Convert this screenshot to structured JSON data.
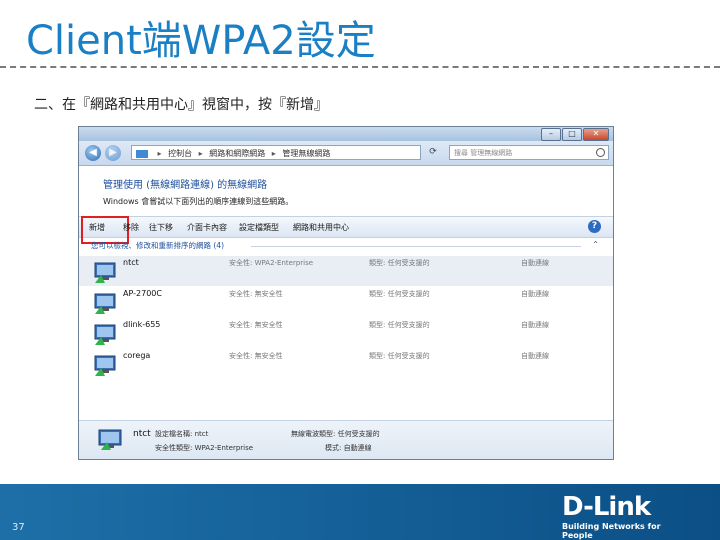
{
  "slide": {
    "title": "Client端WPA2設定",
    "instruction": "二、在『網路和共用中心』視窗中，按『新增』",
    "page_number": "37"
  },
  "window": {
    "controls": {
      "minimize": "–",
      "maximize": "□",
      "close": "✕"
    },
    "address": {
      "crumbs": [
        "控制台",
        "網路和網際網路",
        "管理無線網路"
      ],
      "search_placeholder": "搜尋 管理無線網路"
    },
    "heading": "管理使用 (無線網路連線) 的無線網路",
    "subtext": "Windows 會嘗試以下面列出的順序連線到這些網路。",
    "toolbar": {
      "items": [
        "新增",
        "移除",
        "往下移",
        "介面卡內容",
        "設定檔類型",
        "網路和共用中心"
      ]
    },
    "group_header": "您可以檢視、修改和重新排序的網路 (4)",
    "networks": [
      {
        "name": "ntct",
        "security": "安全性: WPA2-Enterprise",
        "type": "類型: 任何受支援的",
        "mode": "自動連線"
      },
      {
        "name": "AP-2700C",
        "security": "安全性: 無安全性",
        "type": "類型: 任何受支援的",
        "mode": "自動連線"
      },
      {
        "name": "dlink-655",
        "security": "安全性: 無安全性",
        "type": "類型: 任何受支援的",
        "mode": "自動連線"
      },
      {
        "name": "corega",
        "security": "安全性: 無安全性",
        "type": "類型: 任何受支援的",
        "mode": "自動連線"
      }
    ],
    "details": {
      "name": "ntct",
      "profile_label": "設定檔名稱: ntct",
      "security_label": "安全性類型: WPA2-Enterprise",
      "radio_label": "無線電波類型: 任何受支援的",
      "mode_label": "模式: 自動連線"
    }
  },
  "footer": {
    "logo_text": "D-Link",
    "logo_tagline": "Building Networks for People"
  },
  "colors": {
    "title": "#1a7fc4",
    "footer": "#0b4f86",
    "highlight": "#e02020"
  }
}
